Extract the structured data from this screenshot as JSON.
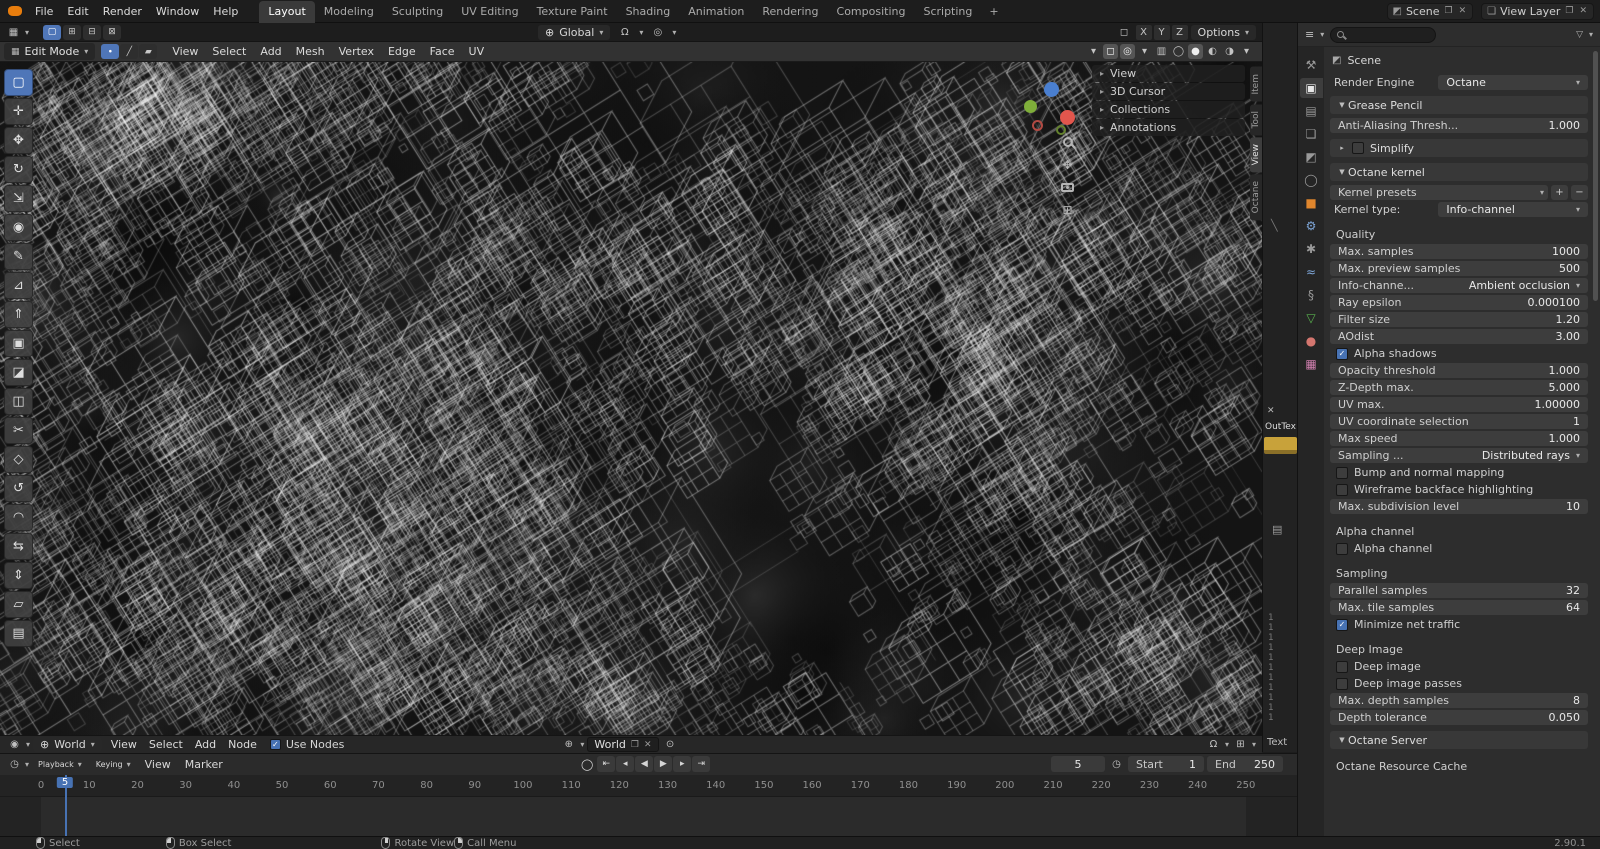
{
  "icons": {
    "chevron_down": "▾",
    "arrow_right": "▸",
    "check": "✓",
    "plus": "+",
    "minus": "−",
    "close": "✕",
    "pin": "⊙",
    "magnet": "Ω",
    "globe": "⊕",
    "proportional": "◎",
    "grid": "⊞",
    "clock": "◷",
    "props_editor": "≡",
    "node_editor": "◉",
    "viewport_editor": "▦",
    "duplicate": "❐",
    "funnel": "▽",
    "page": "▤",
    "diag": "╲",
    "gizmo_box": "◻",
    "move": "✥"
  },
  "topbar": {
    "menus": [
      "File",
      "Edit",
      "Render",
      "Window",
      "Help"
    ],
    "workspaces": [
      {
        "name": "workspace-layout",
        "label": "Layout",
        "state": "active"
      },
      {
        "name": "workspace-modeling",
        "label": "Modeling"
      },
      {
        "name": "workspace-sculpting",
        "label": "Sculpting"
      },
      {
        "name": "workspace-uv-editing",
        "label": "UV Editing"
      },
      {
        "name": "workspace-texture-paint",
        "label": "Texture Paint"
      },
      {
        "name": "workspace-shading",
        "label": "Shading"
      },
      {
        "name": "workspace-animation",
        "label": "Animation"
      },
      {
        "name": "workspace-rendering",
        "label": "Rendering"
      },
      {
        "name": "workspace-compositing",
        "label": "Compositing"
      },
      {
        "name": "workspace-scripting",
        "label": "Scripting"
      }
    ],
    "add_workspace_label": "+",
    "scene_selector": {
      "label": "Scene"
    },
    "view_layer_selector": {
      "label": "View Layer"
    }
  },
  "tool_settings": {
    "modes": [
      {
        "name": "select-mode-new",
        "glyph": "▢",
        "state": "active"
      },
      {
        "name": "select-mode-extend",
        "glyph": "⊞"
      },
      {
        "name": "select-mode-subtract",
        "glyph": "⊟"
      },
      {
        "name": "select-mode-intersect",
        "glyph": "⊠"
      }
    ],
    "orientation": "Global",
    "axis": [
      {
        "name": "mirror-x-toggle",
        "label": "X"
      },
      {
        "name": "mirror-y-toggle",
        "label": "Y"
      },
      {
        "name": "mirror-z-toggle",
        "label": "Z"
      }
    ],
    "options_label": "Options"
  },
  "viewport": {
    "header": {
      "mode": "Edit Mode",
      "select_modes": [
        {
          "name": "vertex-select-mode",
          "glyph": "∙",
          "state": "active"
        },
        {
          "name": "edge-select-mode",
          "glyph": "╱"
        },
        {
          "name": "face-select-mode",
          "glyph": "▰"
        }
      ],
      "menus": [
        "View",
        "Select",
        "Add",
        "Mesh",
        "Vertex",
        "Edge",
        "Face",
        "UV"
      ],
      "right_icons": [
        {
          "name": "object-visibility-dropdown",
          "glyph": "▾"
        },
        {
          "name": "show-gizmo-toggle",
          "glyph": "◻",
          "state": "active"
        },
        {
          "name": "overlays-toggle",
          "glyph": "◎",
          "state": "active"
        },
        {
          "name": "overlays-dropdown",
          "glyph": "▾"
        },
        {
          "name": "xray-toggle",
          "glyph": "▥"
        },
        {
          "name": "shading-wireframe-button",
          "glyph": "◯"
        },
        {
          "name": "shading-solid-button",
          "glyph": "●",
          "state": "active"
        },
        {
          "name": "shading-material-button",
          "glyph": "◐"
        },
        {
          "name": "shading-rendered-button",
          "glyph": "◑"
        },
        {
          "name": "shading-dropdown",
          "glyph": "▾"
        }
      ]
    },
    "npanel": {
      "rows": [
        "View",
        "3D Cursor",
        "Collections",
        "Annotations"
      ],
      "tabs": [
        {
          "name": "npanel-tab-item",
          "label": "Item"
        },
        {
          "name": "npanel-tab-tool",
          "label": "Tool"
        },
        {
          "name": "npanel-tab-view",
          "label": "View",
          "state": "active"
        },
        {
          "name": "npanel-tab-octane",
          "label": "Octane"
        }
      ]
    }
  },
  "toolbar": {
    "tools": [
      {
        "name": "tool-select-box",
        "glyph": "▢",
        "state": "active"
      },
      {
        "name": "tool-cursor",
        "glyph": "✛"
      },
      {
        "name": "tool-move",
        "glyph": "✥"
      },
      {
        "name": "tool-rotate",
        "glyph": "↻"
      },
      {
        "name": "tool-scale",
        "glyph": "⇲"
      },
      {
        "name": "tool-transform",
        "glyph": "◉"
      },
      {
        "name": "tool-annotate",
        "glyph": "✎",
        "gap": "gap"
      },
      {
        "name": "tool-measure",
        "glyph": "⊿"
      },
      {
        "name": "tool-extrude-region",
        "glyph": "⇑",
        "gap": "gap"
      },
      {
        "name": "tool-inset-faces",
        "glyph": "▣"
      },
      {
        "name": "tool-bevel",
        "glyph": "◪"
      },
      {
        "name": "tool-loop-cut",
        "glyph": "◫"
      },
      {
        "name": "tool-knife",
        "glyph": "✂"
      },
      {
        "name": "tool-poly-build",
        "glyph": "◇"
      },
      {
        "name": "tool-spin",
        "glyph": "↺"
      },
      {
        "name": "tool-smooth",
        "glyph": "◠"
      },
      {
        "name": "tool-edge-slide",
        "glyph": "⇆"
      },
      {
        "name": "tool-shrink-fatten",
        "glyph": "⇕"
      },
      {
        "name": "tool-shear",
        "glyph": "▱"
      },
      {
        "name": "tool-rip-region",
        "glyph": "▤"
      }
    ]
  },
  "strip": {
    "node_label": "OutTex",
    "line_numbers": [
      "1",
      "1",
      "1",
      "1",
      "1",
      "1",
      "1",
      "1",
      "1",
      "1",
      "1"
    ],
    "text_editor_label": "Text"
  },
  "shader": {
    "type_label": "World",
    "menus": [
      "View",
      "Select",
      "Add",
      "Node"
    ],
    "use_nodes_label": "Use Nodes",
    "datablock": "World"
  },
  "timeline": {
    "menus": [
      {
        "label": "Playback",
        "state": "chev"
      },
      {
        "label": "Keying",
        "state": "chev"
      },
      {
        "label": "View"
      },
      {
        "label": "Marker"
      }
    ],
    "transport": [
      {
        "name": "auto-keying-toggle",
        "glyph": "◯",
        "kind": "plain"
      },
      {
        "name": "jump-to-start-button",
        "glyph": "⇤"
      },
      {
        "name": "prev-keyframe-button",
        "glyph": "◂"
      },
      {
        "name": "play-reverse-button",
        "glyph": "◀"
      },
      {
        "name": "play-button",
        "glyph": "▶"
      },
      {
        "name": "next-keyframe-button",
        "glyph": "▸"
      },
      {
        "name": "jump-to-end-button",
        "glyph": "⇥"
      }
    ],
    "current_frame": "5",
    "start_label": "Start",
    "start_value": "1",
    "end_label": "End",
    "end_value": "250",
    "ticks": [
      "0",
      "10",
      "20",
      "30",
      "40",
      "50",
      "60",
      "70",
      "80",
      "90",
      "100",
      "110",
      "120",
      "130",
      "140",
      "150",
      "160",
      "170",
      "180",
      "190",
      "200",
      "210",
      "220",
      "230",
      "240",
      "250"
    ]
  },
  "properties": {
    "breadcrumb": "Scene",
    "tabs": [
      {
        "name": "tab-tool",
        "glyph": "⚒"
      },
      {
        "name": "tab-render",
        "glyph": "▣",
        "state": "active"
      },
      {
        "name": "tab-output",
        "glyph": "▤"
      },
      {
        "name": "tab-view-layer",
        "glyph": "❏"
      },
      {
        "name": "tab-scene",
        "glyph": "◩"
      },
      {
        "name": "tab-world",
        "glyph": "◯"
      },
      {
        "name": "tab-object",
        "glyph": "■",
        "color": "#e0862d"
      },
      {
        "name": "tab-modifiers",
        "glyph": "⚙",
        "color": "#7ea6d8"
      },
      {
        "name": "tab-particles",
        "glyph": "✱"
      },
      {
        "name": "tab-physics",
        "glyph": "≈",
        "color": "#7ea6d8"
      },
      {
        "name": "tab-constraints",
        "glyph": "§"
      },
      {
        "name": "tab-object-data",
        "glyph": "▽",
        "color": "#59b34e"
      },
      {
        "name": "tab-material",
        "glyph": "●",
        "color": "#d4766f"
      },
      {
        "name": "tab-texture",
        "glyph": "▦",
        "color": "#cf7fae"
      }
    ],
    "rows": [
      {
        "type": "field",
        "label": "Render Engine",
        "value": "Octane"
      },
      {
        "type": "section",
        "label": "Grease Pencil",
        "arrow": "▼"
      },
      {
        "type": "slider",
        "label": "Anti-Aliasing Thresh...",
        "value": "1.000"
      },
      {
        "type": "section-check",
        "label": "Simplify",
        "arrow": "▸",
        "state": "off"
      },
      {
        "type": "section",
        "label": "Octane kernel",
        "arrow": "▼"
      },
      {
        "type": "dropdown-plus",
        "label": "Kernel presets"
      },
      {
        "type": "field",
        "label": "Kernel type:",
        "value": "Info-channel"
      },
      {
        "type": "subheader",
        "label": "Quality"
      },
      {
        "type": "slider",
        "label": "Max. samples",
        "value": "1000"
      },
      {
        "type": "slider",
        "label": "Max. preview samples",
        "value": "500"
      },
      {
        "type": "dropdown",
        "label": "Info-channe...",
        "value": "Ambient occlusion"
      },
      {
        "type": "slider",
        "label": "Ray epsilon",
        "value": "0.000100"
      },
      {
        "type": "slider",
        "label": "Filter size",
        "value": "1.20"
      },
      {
        "type": "slider",
        "label": "AOdist",
        "value": "3.00"
      },
      {
        "type": "check",
        "label": "Alpha shadows",
        "state": "on"
      },
      {
        "type": "slider",
        "label": "Opacity threshold",
        "value": "1.000"
      },
      {
        "type": "slider",
        "label": "Z-Depth max.",
        "value": "5.000"
      },
      {
        "type": "slider",
        "label": "UV max.",
        "value": "1.00000"
      },
      {
        "type": "slider",
        "label": "UV coordinate selection",
        "value": "1"
      },
      {
        "type": "slider",
        "label": "Max speed",
        "value": "1.000"
      },
      {
        "type": "dropdown",
        "label": "Sampling ...",
        "value": "Distributed rays"
      },
      {
        "type": "check",
        "label": "Bump and normal mapping",
        "state": "off"
      },
      {
        "type": "check",
        "label": "Wireframe backface highlighting",
        "state": "off"
      },
      {
        "type": "slider",
        "label": "Max. subdivision level",
        "value": "10"
      },
      {
        "type": "subheader",
        "label": "Alpha channel"
      },
      {
        "type": "check",
        "label": "Alpha channel",
        "state": "off"
      },
      {
        "type": "subheader",
        "label": "Sampling"
      },
      {
        "type": "slider",
        "label": "Parallel samples",
        "value": "32"
      },
      {
        "type": "slider",
        "label": "Max. tile samples",
        "value": "64"
      },
      {
        "type": "check",
        "label": "Minimize net traffic",
        "state": "on"
      },
      {
        "type": "subheader",
        "label": "Deep Image"
      },
      {
        "type": "check",
        "label": "Deep image",
        "state": "off"
      },
      {
        "type": "check",
        "label": "Deep image passes",
        "state": "off"
      },
      {
        "type": "slider",
        "label": "Max. depth samples",
        "value": "8"
      },
      {
        "type": "slider",
        "label": "Depth tolerance",
        "value": "0.050"
      },
      {
        "type": "section",
        "label": "Octane Server",
        "arrow": "▼"
      },
      {
        "type": "subheader",
        "label": "Octane Resource Cache"
      }
    ]
  },
  "statusbar": {
    "items": [
      {
        "name": "status-select",
        "label": "Select",
        "btn": "left"
      },
      {
        "name": "status-box-select",
        "label": "Box Select",
        "btn": "drag"
      },
      {
        "name": "status-rotate-view",
        "label": "Rotate View",
        "btn": "middle"
      },
      {
        "name": "status-call-menu",
        "label": "Call Menu",
        "btn": "right"
      }
    ],
    "version": "2.90.1"
  },
  "colors": {
    "accent": "#4772b3",
    "active_tool": "#4f76b8",
    "node_swatch_yellow": "#c8a23a",
    "axis_x": "#e2564d",
    "axis_y": "#7fae3a",
    "axis_z": "#4a7fd0"
  }
}
